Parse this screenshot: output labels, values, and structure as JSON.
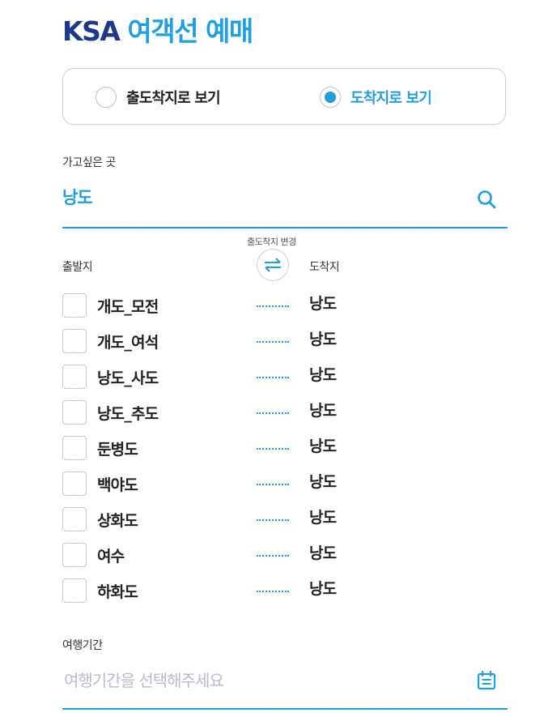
{
  "header": {
    "title_ksa": "KSA",
    "title_rest": "여객선 예매"
  },
  "view_mode": {
    "options": [
      {
        "label": "출도착지로 보기",
        "selected": false
      },
      {
        "label": "도착지로 보기",
        "selected": true
      }
    ]
  },
  "destination": {
    "label": "가고싶은 곳",
    "value": "낭도",
    "search_icon": "search-icon"
  },
  "swap": {
    "label": "출도착지 변경",
    "icon": "swap-arrows-icon"
  },
  "columns": {
    "departure": "출발지",
    "arrival": "도착지"
  },
  "routes": [
    {
      "departure": "개도_모전",
      "arrival": "낭도"
    },
    {
      "departure": "개도_여석",
      "arrival": "낭도"
    },
    {
      "departure": "낭도_사도",
      "arrival": "낭도"
    },
    {
      "departure": "낭도_추도",
      "arrival": "낭도"
    },
    {
      "departure": "둔병도",
      "arrival": "낭도"
    },
    {
      "departure": "백야도",
      "arrival": "낭도"
    },
    {
      "departure": "상화도",
      "arrival": "낭도"
    },
    {
      "departure": "여수",
      "arrival": "낭도"
    },
    {
      "departure": "하화도",
      "arrival": "낭도"
    }
  ],
  "period": {
    "label": "여행기간",
    "placeholder": "여행기간을 선택해주세요",
    "icon": "calendar-icon"
  },
  "colors": {
    "brand_dark": "#1b3a8a",
    "accent": "#1f9fe0",
    "placeholder": "#b9bcc6"
  }
}
